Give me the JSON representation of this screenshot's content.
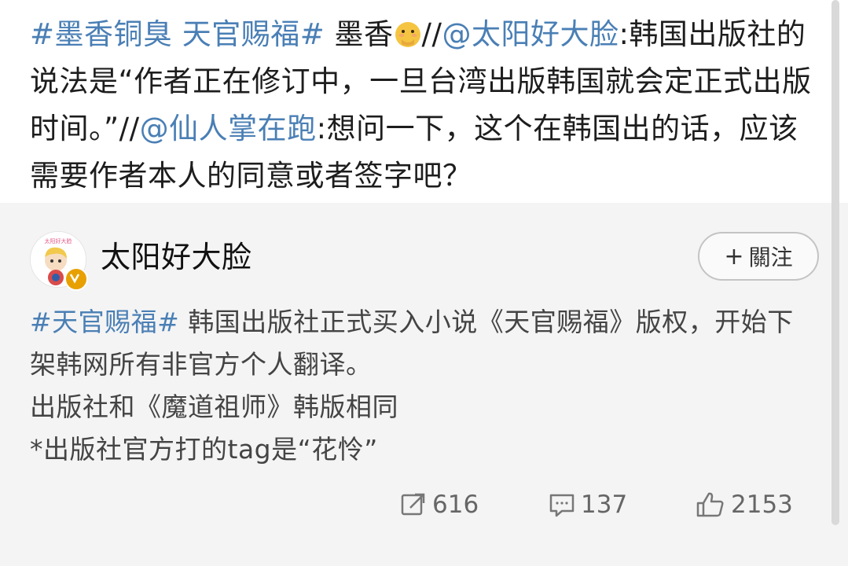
{
  "post": {
    "segments": [
      {
        "text": "#墨香铜臭 天官赐福#",
        "link": true
      },
      {
        "text": " 墨香",
        "link": false
      },
      {
        "text": "//",
        "link": false
      },
      {
        "text": "@太阳好大脸",
        "link": true
      },
      {
        "text": ":韩国出版社的说法是“作者正在修订中，一旦台湾出版韩国就会定正式出版时间。”//",
        "link": false
      },
      {
        "text": "@仙人掌在跑",
        "link": true
      },
      {
        "text": ":想问一下，这个在韩国出的话，应该需要作者本人的同意或者签字吧？",
        "link": false
      }
    ],
    "emoji": "flushed-hand-over-mouth-emoji"
  },
  "repost": {
    "username": "太阳好大脸",
    "avatar_caption": "太阳好大脸",
    "follow_label": "關注",
    "follow_icon": "plus-icon",
    "hashtag": "#天官赐福#",
    "line1_rest": " 韩国出版社正式买入小说《天官赐福》版权，开始下架韩网所有非官方个人翻译。",
    "line2": "出版社和《魔道祖师》韩版相同",
    "line3": "*出版社官方打的tag是“花怜”"
  },
  "actions": {
    "repost_count": "616",
    "comment_count": "137",
    "like_count": "2153"
  },
  "colors": {
    "link": "#4a7fb5",
    "repost_bg": "#f4f4f4",
    "verified_badge": "#e8a000"
  }
}
